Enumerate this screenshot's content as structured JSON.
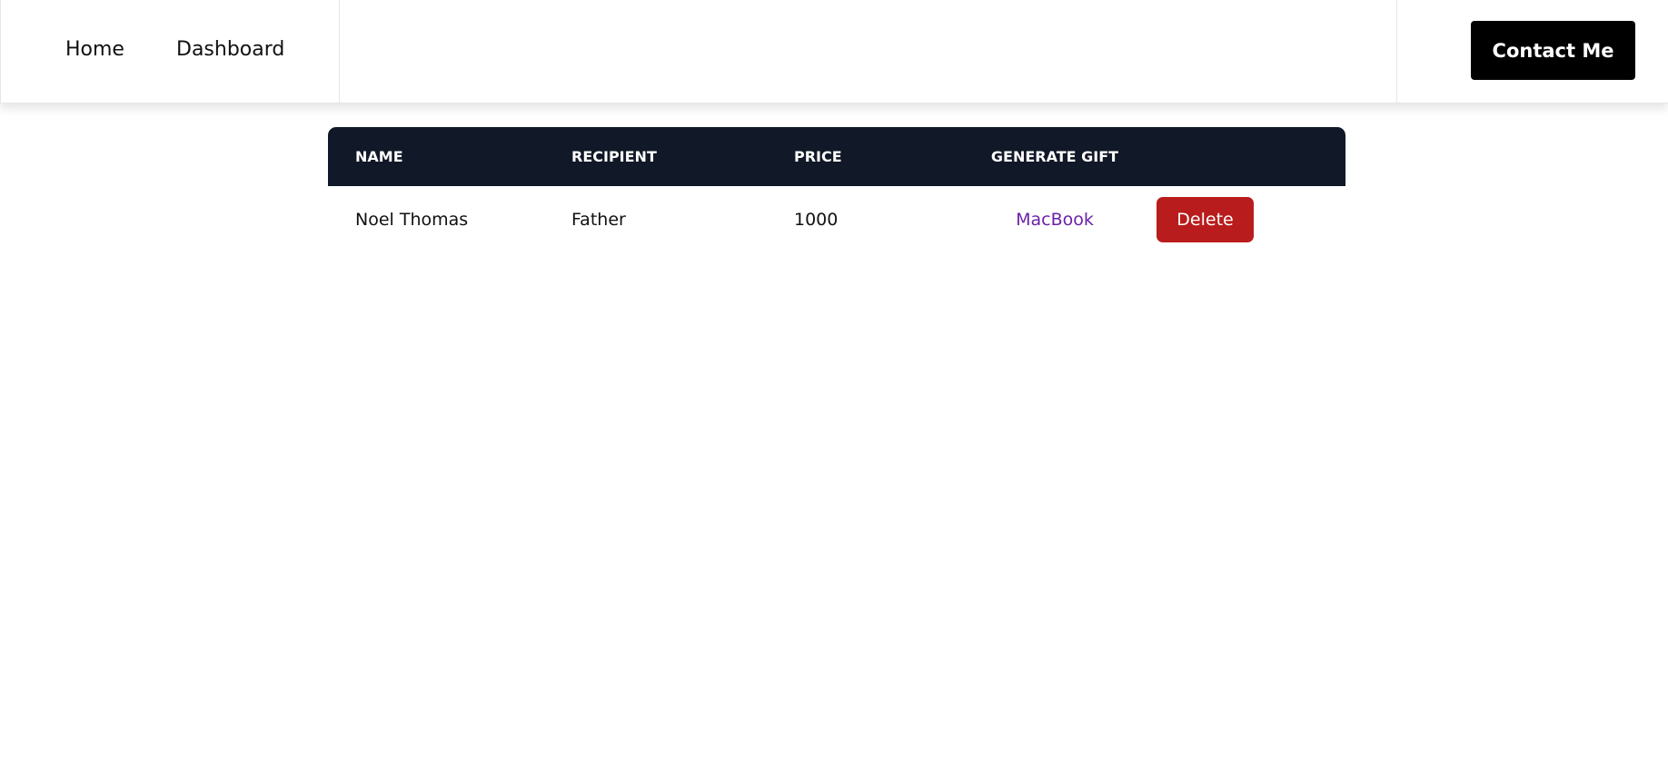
{
  "nav": {
    "links": [
      "Home",
      "Dashboard"
    ],
    "contact_label": "Contact Me"
  },
  "table": {
    "headers": [
      "NAME",
      "RECIPIENT",
      "PRICE",
      "GENERATE GIFT"
    ],
    "rows": [
      {
        "name": "Noel Thomas",
        "recipient": "Father",
        "price": "1000",
        "gift": "MacBook",
        "action_label": "Delete"
      }
    ]
  },
  "colors": {
    "header_bg": "#111827",
    "gift_link": "#6b21a8",
    "delete_button": "#b91c1c",
    "contact_button": "#000000"
  }
}
